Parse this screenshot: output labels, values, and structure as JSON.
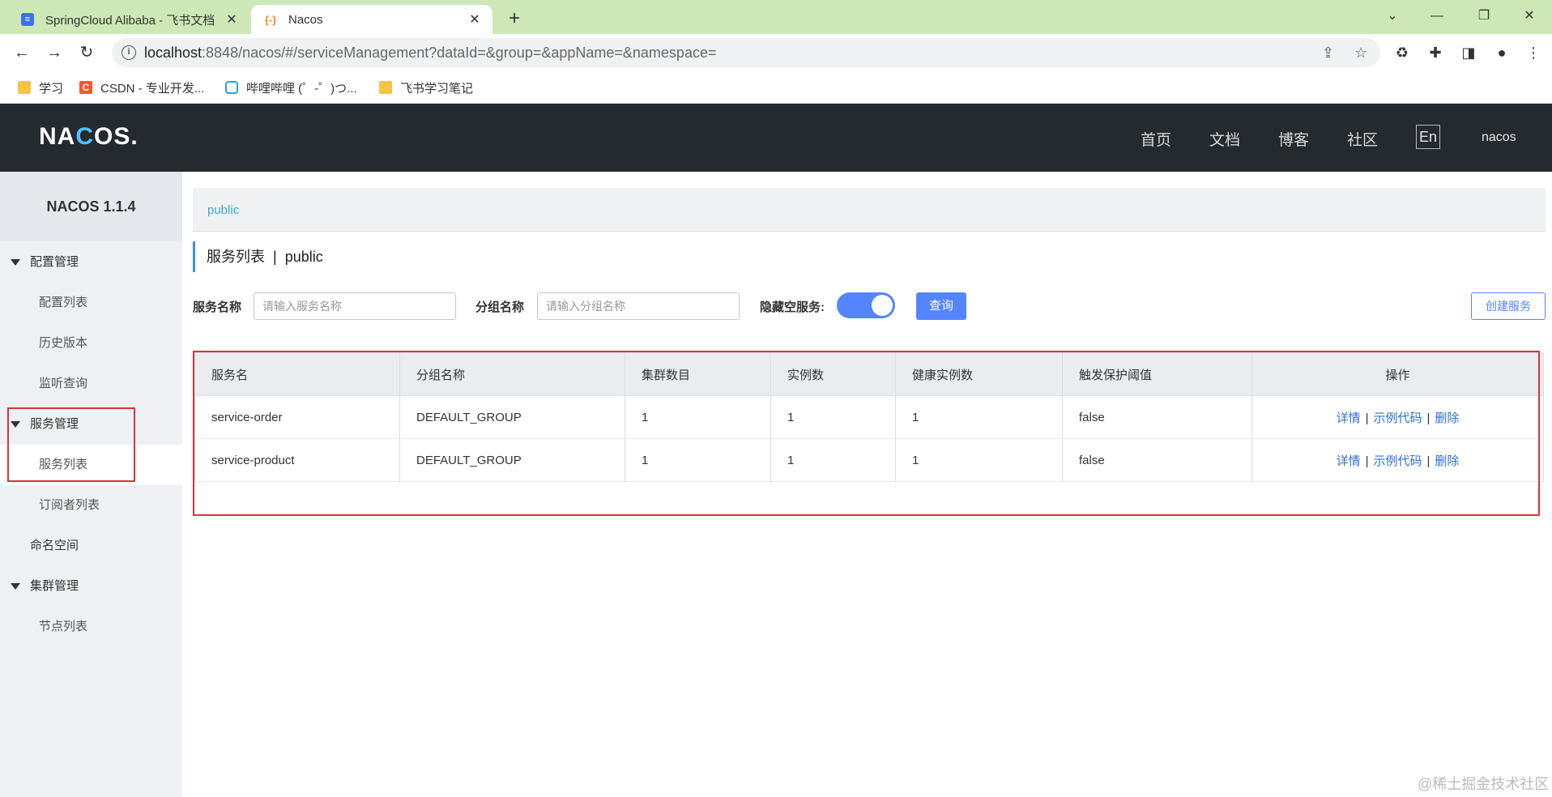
{
  "browser": {
    "tabs": [
      {
        "title": "SpringCloud Alibaba - 飞书文档",
        "icon": "doc-icon"
      },
      {
        "title": "Nacos",
        "icon": "nacos-icon"
      }
    ],
    "url_host": "localhost",
    "url_rest": ":8848/nacos/#/serviceManagement?dataId=&group=&appName=&namespace=",
    "bookmarks": [
      {
        "label": "学习",
        "icon": "folder-icon"
      },
      {
        "label": "CSDN - 专业开发...",
        "icon": "csdn-icon"
      },
      {
        "label": "哔哩哔哩 (゜-゜)つ...",
        "icon": "bilibili-icon"
      },
      {
        "label": "飞书学习笔记",
        "icon": "folder-icon"
      }
    ]
  },
  "header": {
    "logo": "NACOS.",
    "menu": [
      "首页",
      "文档",
      "博客",
      "社区"
    ],
    "lang": "En",
    "user": "nacos"
  },
  "sidebar": {
    "version": "NACOS 1.1.4",
    "groups": [
      {
        "label": "配置管理",
        "items": [
          "配置列表",
          "历史版本",
          "监听查询"
        ]
      },
      {
        "label": "服务管理",
        "items": [
          "服务列表",
          "订阅者列表"
        ]
      },
      {
        "label": "命名空间",
        "items": []
      },
      {
        "label": "集群管理",
        "items": [
          "节点列表"
        ]
      }
    ],
    "active_item": "服务列表"
  },
  "main": {
    "namespace": "public",
    "title": "服务列表",
    "title_ns": "public",
    "filters": {
      "service_label": "服务名称",
      "service_placeholder": "请输入服务名称",
      "group_label": "分组名称",
      "group_placeholder": "请输入分组名称",
      "hide_empty_label": "隐藏空服务:",
      "hide_empty_on": true,
      "query_label": "查询",
      "create_label": "创建服务"
    },
    "table": {
      "headers": [
        "服务名",
        "分组名称",
        "集群数目",
        "实例数",
        "健康实例数",
        "触发保护阈值",
        "操作"
      ],
      "rows": [
        {
          "name": "service-order",
          "group": "DEFAULT_GROUP",
          "clusters": "1",
          "instances": "1",
          "healthy": "1",
          "threshold": "false"
        },
        {
          "name": "service-product",
          "group": "DEFAULT_GROUP",
          "clusters": "1",
          "instances": "1",
          "healthy": "1",
          "threshold": "false"
        }
      ],
      "actions": [
        "详情",
        "示例代码",
        "删除"
      ],
      "action_sep": "|"
    }
  },
  "watermark": "@稀土掘金技术社区",
  "colors": {
    "accent": "#5584ff",
    "header_bg": "#252a2f",
    "highlight_border": "#d9353a",
    "tab_bar": "#cde8b6"
  }
}
